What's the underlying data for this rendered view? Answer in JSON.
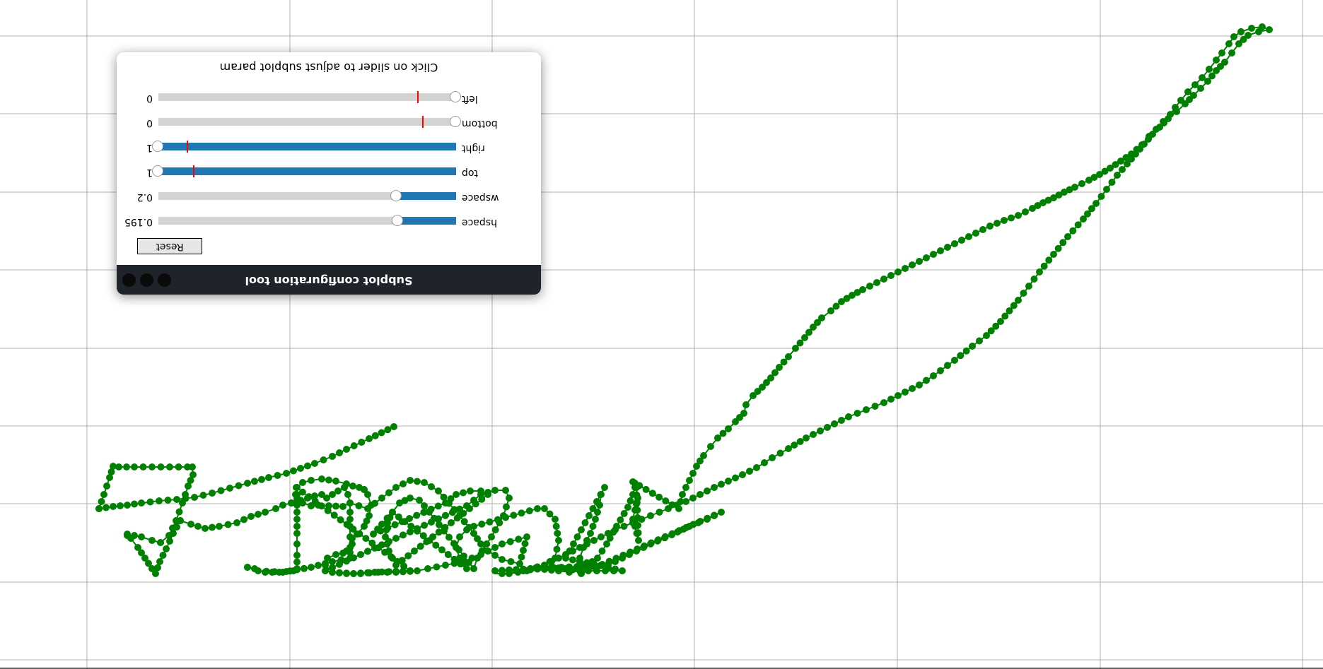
{
  "dialog": {
    "title": "Subplot configuration tool",
    "hint": "Click on slider to adjust subplot param",
    "reset_label": "Reset",
    "sliders": [
      {
        "name": "hspace",
        "value": "0.195",
        "fraction": 0.195
      },
      {
        "name": "wspace",
        "value": "0.2",
        "fraction": 0.2
      },
      {
        "name": "top",
        "value": "1",
        "fraction": 1.0,
        "default": 0.88
      },
      {
        "name": "right",
        "value": "1",
        "fraction": 1.0,
        "default": 0.9
      },
      {
        "name": "bottom",
        "value": "0",
        "fraction": 0.0,
        "default": 0.11
      },
      {
        "name": "left",
        "value": "0",
        "fraction": 0.0,
        "default": 0.125
      }
    ]
  },
  "plot": {
    "line_color": "#008000",
    "grid": true,
    "accent_colors": {
      "slider_fill": "#1f77b4",
      "slider_track": "#d3d3d3",
      "default_marker": "#ff0000",
      "titlebar": "#1f232a"
    }
  }
}
